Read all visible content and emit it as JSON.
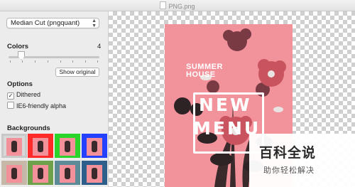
{
  "window": {
    "title": "PNG.png"
  },
  "sidebar": {
    "quantizer": {
      "selected": "Median Cut (pngquant)"
    },
    "colors": {
      "label": "Colors",
      "value": "4",
      "slider_fraction": 0.1
    },
    "show_original_label": "Show original",
    "options": {
      "label": "Options",
      "dithered": {
        "label": "Dithered",
        "checked": true
      },
      "ie6": {
        "label": "IE6-friendly alpha",
        "checked": false
      }
    },
    "backgrounds": {
      "label": "Backgrounds",
      "swatches": [
        {
          "color": "#c8c8c8",
          "selected": true
        },
        {
          "color": "#ff2a2a",
          "selected": false
        },
        {
          "color": "#2bd42b",
          "selected": false
        },
        {
          "color": "#2441ff",
          "selected": false
        }
      ]
    }
  },
  "canvas": {
    "poster": {
      "line1": "SUMMER",
      "line2": "HOUSE",
      "word1": "NEW",
      "word2": "MENU"
    }
  },
  "watermark": {
    "line1": "百科全说",
    "line2": "助你轻松解决"
  }
}
